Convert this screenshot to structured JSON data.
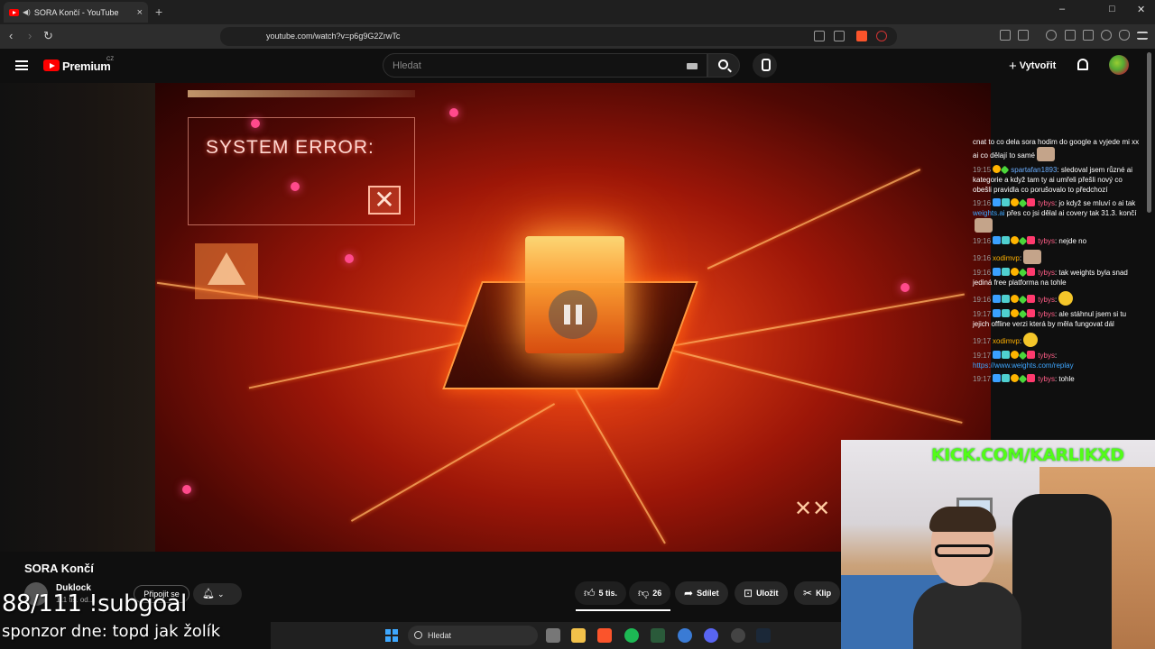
{
  "browser": {
    "tab_title": "SORA Končí - YouTube",
    "tab_close": "×",
    "new_tab": "+",
    "url": "youtube.com/watch?v=p6g9G2ZrwTc",
    "window_controls": {
      "minimize": "–",
      "maximize": "□",
      "close": "✕"
    },
    "nav": {
      "back": "‹",
      "forward": "›",
      "reload": "↻"
    }
  },
  "youtube": {
    "brand": "Premium",
    "country": "CZ",
    "search_placeholder": "Hledat",
    "create_label": "Vytvořit",
    "create_plus": "+"
  },
  "video": {
    "error_text": "SYSTEM ERROR:",
    "error_x": "✕",
    "state": "paused"
  },
  "chat": [
    {
      "ts": "",
      "user": "",
      "text": "cnat to co dela sora hodim do google a vyjede mi xx ai co dělají to samé",
      "badges": 0
    },
    {
      "ts": "19:15",
      "user": "spartafan1893",
      "user_color": "user1",
      "text": ": sledoval jsem různé ai kategorie a když tam ty ai umřeli přešli nový co obešli pravidla co porušovalo to předchozí",
      "badges": 2
    },
    {
      "ts": "19:16",
      "user": "tybys",
      "user_color": "user2",
      "text": ": jo když se mluví o ai tak",
      "link": "weights.ai",
      "text2": " přes co jsi dělal ai covery tak 31.3. končí",
      "badges": 5
    },
    {
      "ts": "19:16",
      "user": "tybys",
      "user_color": "user2",
      "text": ": nejde no",
      "badges": 5
    },
    {
      "ts": "19:16",
      "user": "xodimvp",
      "user_color": "user3",
      "text": ":",
      "badges": 0
    },
    {
      "ts": "19:16",
      "user": "tybys",
      "user_color": "user2",
      "text": ": tak weights byla snad jediná free platforma na tohle",
      "badges": 5
    },
    {
      "ts": "19:16",
      "user": "tybys",
      "user_color": "user2",
      "text": ":",
      "badges": 5
    },
    {
      "ts": "19:17",
      "user": "tybys",
      "user_color": "user2",
      "text": ": ale stáhnul jsem si tu jejich offline verzi která by měla fungovat dál",
      "badges": 5
    },
    {
      "ts": "19:17",
      "user": "xodimvp",
      "user_color": "user3",
      "text": ":",
      "badges": 0
    },
    {
      "ts": "19:17",
      "user": "tybys",
      "user_color": "user2",
      "text": ":",
      "link": "https://www.weights.com/replay",
      "badges": 5
    },
    {
      "ts": "19:17",
      "user": "tybys",
      "user_color": "user2",
      "text": ": tohle",
      "badges": 5
    }
  ],
  "webcam": {
    "overlay_text": "KICK.COM/KARLIKXD"
  },
  "below_video": {
    "title": "SORA Končí",
    "channel": "Duklock",
    "subs": "111 tis. od...",
    "join_label": "Připojit se",
    "likes": "5 tis.",
    "dislikes": "26",
    "share": "Sdílet",
    "save": "Uložit",
    "clip": "Klip"
  },
  "stream_overlay": {
    "subgoal": "88/111 !subgoal",
    "sponsor": "sponzor dne: topd jak žolík"
  },
  "taskbar": {
    "search_placeholder": "Hledat"
  },
  "colors": {
    "youtube_red": "#ff0000",
    "kick_green": "#53fc18",
    "link_blue": "#3ea6ff"
  }
}
